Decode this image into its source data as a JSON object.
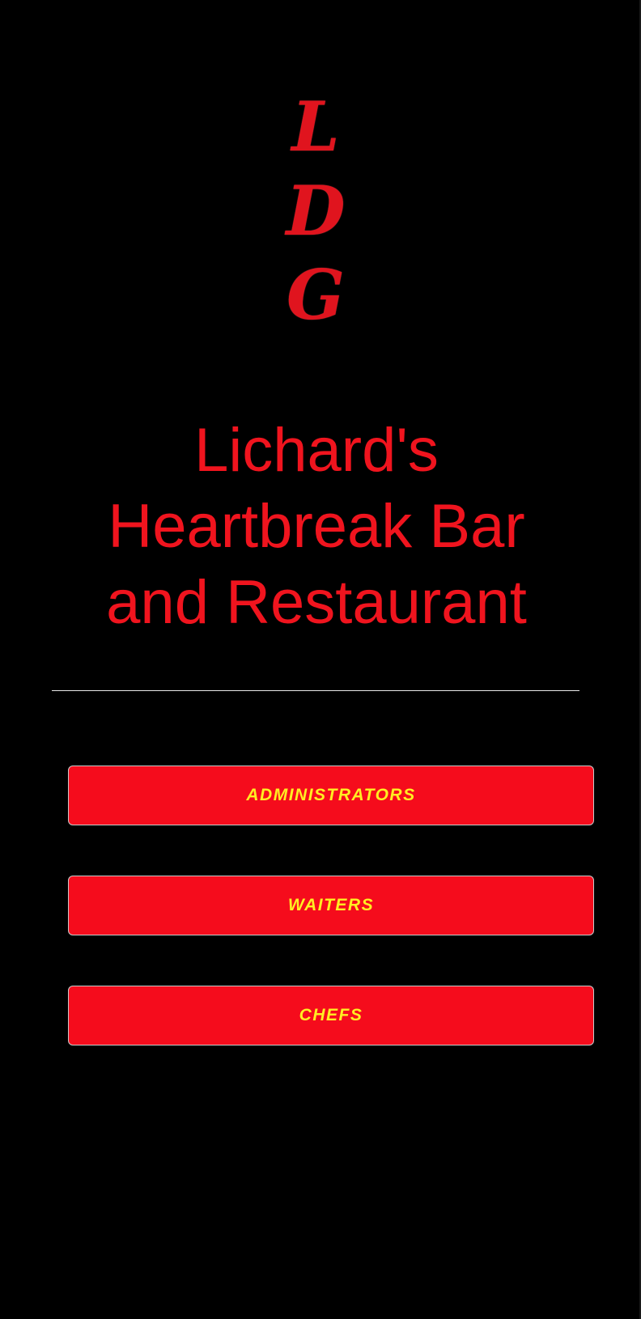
{
  "logo": {
    "letters": [
      "L",
      "D",
      "G"
    ],
    "color": "#e0141e"
  },
  "title": {
    "lines": [
      "Lichard's",
      "Heartbreak Bar",
      "and Restaurant"
    ],
    "color": "#f0141e"
  },
  "buttons": {
    "administrators": "ADMINISTRATORS",
    "waiters": "WAITERS",
    "chefs": "CHEFS"
  },
  "colors": {
    "background": "#000000",
    "button_fill": "#f50c1c",
    "button_text": "#ffee22",
    "divider": "#e8e8e8"
  }
}
